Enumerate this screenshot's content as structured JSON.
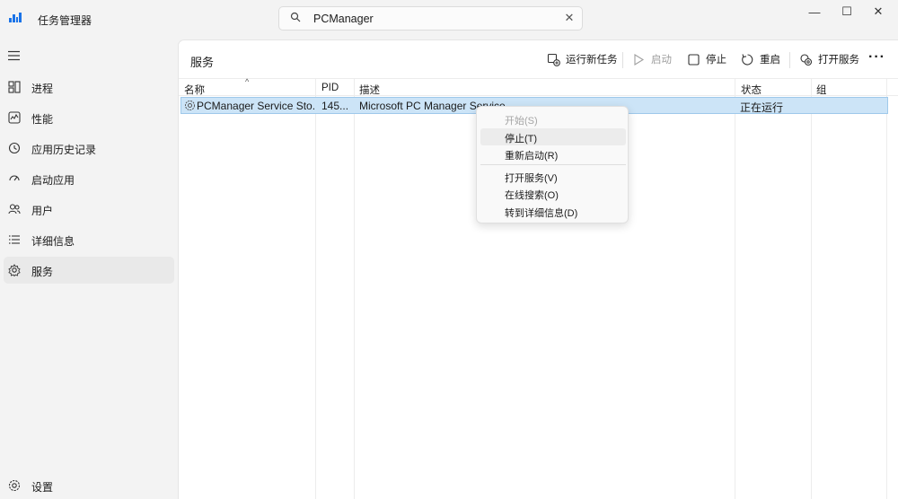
{
  "app": {
    "title": "任务管理器"
  },
  "search": {
    "value": "PCManager",
    "clear_label": "✕"
  },
  "window_controls": {
    "minimize": "—",
    "maximize": "☐",
    "close": "✕"
  },
  "sidebar": {
    "items": [
      {
        "label": "进程",
        "icon": "processes-icon"
      },
      {
        "label": "性能",
        "icon": "performance-icon"
      },
      {
        "label": "应用历史记录",
        "icon": "app-history-icon"
      },
      {
        "label": "启动应用",
        "icon": "startup-apps-icon"
      },
      {
        "label": "用户",
        "icon": "users-icon"
      },
      {
        "label": "详细信息",
        "icon": "details-icon"
      },
      {
        "label": "服务",
        "icon": "services-icon",
        "active": true
      }
    ],
    "settings_label": "设置"
  },
  "main": {
    "title": "服务",
    "toolbar": {
      "run_new_task": "运行新任务",
      "start": "启动",
      "stop": "停止",
      "restart": "重启",
      "open_services": "打开服务",
      "more": "···"
    },
    "columns": {
      "name": "名称",
      "pid": "PID",
      "description": "描述",
      "status": "状态",
      "group": "组"
    },
    "rows": [
      {
        "name": "PCManager Service Sto...",
        "pid": "145...",
        "description": "Microsoft PC Manager Service",
        "status": "正在运行",
        "group": ""
      }
    ]
  },
  "context_menu": {
    "items": [
      {
        "label": "开始(S)",
        "disabled": true
      },
      {
        "label": "停止(T)",
        "hover": true
      },
      {
        "label": "重新启动(R)"
      },
      {
        "label": "打开服务(V)"
      },
      {
        "label": "在线搜索(O)"
      },
      {
        "label": "转到详细信息(D)"
      }
    ]
  },
  "colors": {
    "accent": "#1a73e8",
    "selection": "#cce4f7",
    "background": "#f3f3f3",
    "panel": "#ffffff"
  }
}
